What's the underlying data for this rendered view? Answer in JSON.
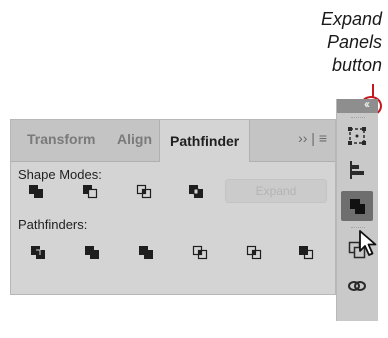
{
  "callout": {
    "line1": "Expand",
    "line2": "Panels",
    "line3": "button"
  },
  "dock": {
    "collapse_glyph": "‹‹"
  },
  "panel": {
    "tabs": [
      {
        "label": "Transform",
        "active": false
      },
      {
        "label": "Align",
        "active": false
      },
      {
        "label": "Pathfinder",
        "active": true
      }
    ],
    "tab_menu": "›› | ≡",
    "shape_modes_label": "Shape Modes:",
    "pathfinders_label": "Pathfinders:",
    "expand_label": "Expand",
    "shape_mode_buttons": [
      "unite-icon",
      "minus-front-icon",
      "intersect-icon",
      "exclude-icon"
    ],
    "pathfinder_buttons": [
      "divide-icon",
      "trim-icon",
      "merge-icon",
      "crop-icon",
      "outline-icon",
      "minus-back-icon"
    ]
  },
  "dock_buttons": [
    "transform-icon",
    "align-icon",
    "pathfinder-icon",
    "symbols-icon",
    "links-icon"
  ],
  "colors": {
    "accent_red": "#c8161d",
    "panel_bg": "#d4d4d4",
    "dock_active": "#6e6e6e",
    "icon_dark": "#1e1e1e"
  }
}
